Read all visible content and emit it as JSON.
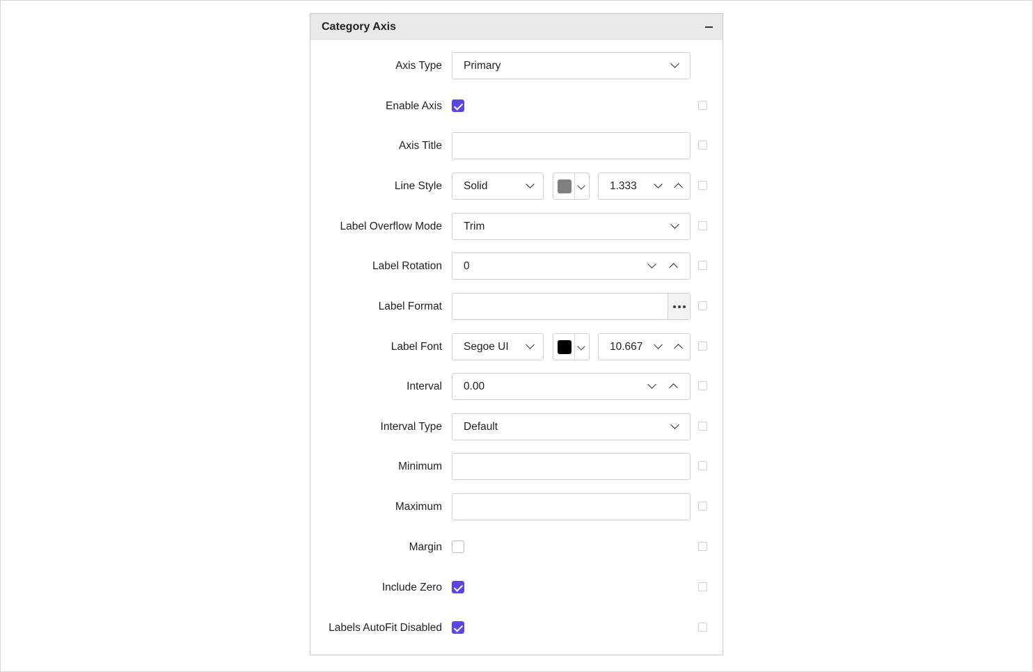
{
  "panel": {
    "title": "Category Axis"
  },
  "fields": {
    "axis_type": {
      "label": "Axis Type",
      "value": "Primary"
    },
    "enable_axis": {
      "label": "Enable Axis",
      "checked": true
    },
    "axis_title": {
      "label": "Axis Title",
      "value": ""
    },
    "line_style": {
      "label": "Line Style",
      "style": "Solid",
      "color": "#808080",
      "width": "1.333"
    },
    "label_overflow_mode": {
      "label": "Label Overflow Mode",
      "value": "Trim"
    },
    "label_rotation": {
      "label": "Label Rotation",
      "value": "0"
    },
    "label_format": {
      "label": "Label Format",
      "value": ""
    },
    "label_font": {
      "label": "Label Font",
      "family": "Segoe UI",
      "color": "#000000",
      "size": "10.667"
    },
    "interval": {
      "label": "Interval",
      "value": "0.00"
    },
    "interval_type": {
      "label": "Interval Type",
      "value": "Default"
    },
    "minimum": {
      "label": "Minimum",
      "value": ""
    },
    "maximum": {
      "label": "Maximum",
      "value": ""
    },
    "margin": {
      "label": "Margin",
      "checked": false
    },
    "include_zero": {
      "label": "Include Zero",
      "checked": true
    },
    "labels_autofit_disabled": {
      "label": "Labels AutoFit Disabled",
      "checked": true
    }
  },
  "colors": {
    "accent": "#5b46e4",
    "header_bg": "#e9e9ea",
    "border": "#cfcfcf"
  }
}
